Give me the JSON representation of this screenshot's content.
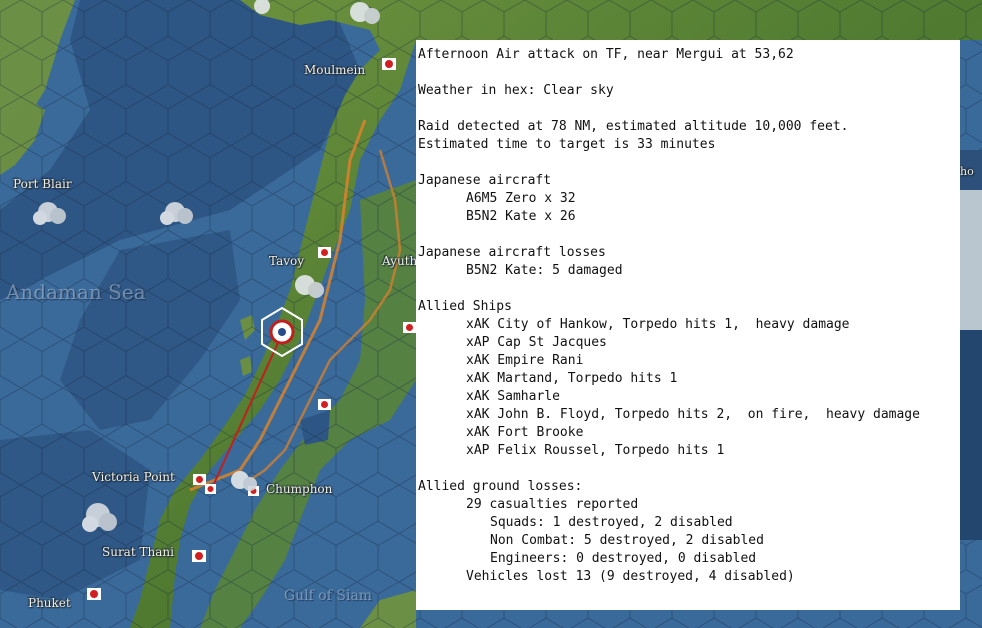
{
  "map": {
    "places": {
      "moulmein": "Moulmein",
      "port_blair": "Port Blair",
      "tavoy": "Tavoy",
      "ayuth": "Ayuth",
      "victoria_point": "Victoria Point",
      "chumphon": "Chumphon",
      "surat_thani": "Surat Thani",
      "phuket": "Phuket",
      "edge_label": "ho"
    },
    "seas": {
      "andaman": "Andaman Sea",
      "gulf_of_siam": "Gulf of Siam"
    },
    "colors": {
      "ocean": "#3a6a9a",
      "deep_ocean": "#2e5684",
      "land": "#5f8a3a",
      "route": "#d9822b",
      "attack_line": "#c0201e",
      "base_marker": "#d02020"
    }
  },
  "report": {
    "title": "Afternoon Air attack on TF, near Mergui at 53,62",
    "weather": "Weather in hex: Clear sky",
    "raid_detected": "Raid detected at 78 NM, estimated altitude 10,000 feet.",
    "time_to_target": "Estimated time to target is 33 minutes",
    "japanese_aircraft_header": "Japanese aircraft",
    "japanese_aircraft": [
      "A6M5 Zero x 32",
      "B5N2 Kate x 26"
    ],
    "japanese_losses_header": "Japanese aircraft losses",
    "japanese_losses": [
      "B5N2 Kate: 5 damaged"
    ],
    "allied_ships_header": "Allied Ships",
    "allied_ships": [
      "xAK City of Hankow, Torpedo hits 1,  heavy damage",
      "xAP Cap St Jacques",
      "xAK Empire Rani",
      "xAK Martand, Torpedo hits 1",
      "xAK Samharle",
      "xAK John B. Floyd, Torpedo hits 2,  on fire,  heavy damage",
      "xAK Fort Brooke",
      "xAP Felix Roussel, Torpedo hits 1"
    ],
    "ground_losses_header": "Allied ground losses:",
    "casualties": "29 casualties reported",
    "squads": "Squads: 1 destroyed, 2 disabled",
    "non_combat": "Non Combat: 5 destroyed, 2 disabled",
    "engineers": "Engineers: 0 destroyed, 0 disabled",
    "vehicles": "Vehicles lost 13 (9 destroyed, 4 disabled)"
  }
}
